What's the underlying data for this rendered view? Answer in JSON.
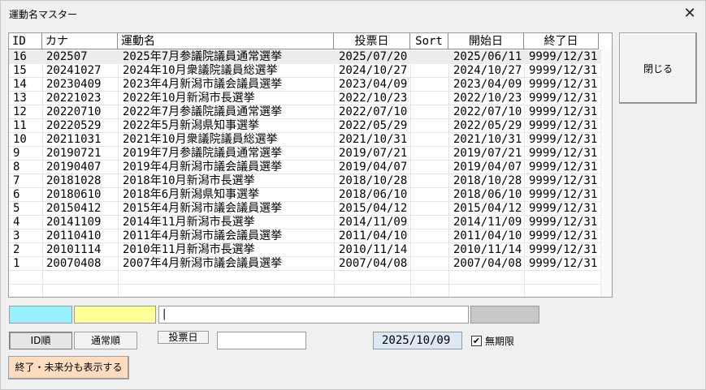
{
  "window": {
    "title": "運動名マスター",
    "close_glyph": "✕"
  },
  "table": {
    "columns": [
      "ID",
      "カナ",
      "運動名",
      "投票日",
      "Sort",
      "開始日",
      "終了日"
    ],
    "rows": [
      [
        "16",
        "202507",
        "2025年7月参議院議員通常選挙",
        "2025/07/20",
        "",
        "2025/06/11",
        "9999/12/31"
      ],
      [
        "15",
        "20241027",
        "2024年10月衆議院議員総選挙",
        "2024/10/27",
        "",
        "2024/10/27",
        "9999/12/31"
      ],
      [
        "14",
        "20230409",
        "2023年4月新潟市議会議員選挙",
        "2023/04/09",
        "",
        "2023/04/09",
        "9999/12/31"
      ],
      [
        "13",
        "20221023",
        "2022年10月新潟市長選挙",
        "2022/10/23",
        "",
        "2022/10/23",
        "9999/12/31"
      ],
      [
        "12",
        "20220710",
        "2022年7月参議院議員通常選挙",
        "2022/07/10",
        "",
        "2022/07/10",
        "9999/12/31"
      ],
      [
        "11",
        "20220529",
        "2022年5月新潟県知事選挙",
        "2022/05/29",
        "",
        "2022/05/29",
        "9999/12/31"
      ],
      [
        "10",
        "20211031",
        "2021年10月衆議院議員総選挙",
        "2021/10/31",
        "",
        "2021/10/31",
        "9999/12/31"
      ],
      [
        "9",
        "20190721",
        "2019年7月参議院議員通常選挙",
        "2019/07/21",
        "",
        "2019/07/21",
        "9999/12/31"
      ],
      [
        "8",
        "20190407",
        "2019年4月新潟市議会議員選挙",
        "2019/04/07",
        "",
        "2019/04/07",
        "9999/12/31"
      ],
      [
        "7",
        "20181028",
        "2018年10月新潟市長選挙",
        "2018/10/28",
        "",
        "2018/10/28",
        "9999/12/31"
      ],
      [
        "6",
        "20180610",
        "2018年6月新潟県知事選挙",
        "2018/06/10",
        "",
        "2018/06/10",
        "9999/12/31"
      ],
      [
        "5",
        "20150412",
        "2015年4月新潟市議会議員選挙",
        "2015/04/12",
        "",
        "2015/04/12",
        "9999/12/31"
      ],
      [
        "4",
        "20141109",
        "2014年11月新潟市長選挙",
        "2014/11/09",
        "",
        "2014/11/09",
        "9999/12/31"
      ],
      [
        "3",
        "20110410",
        "2011年4月新潟市議会議員選挙",
        "2011/04/10",
        "",
        "2011/04/10",
        "9999/12/31"
      ],
      [
        "2",
        "20101114",
        "2010年11月新潟市長選挙",
        "2010/11/14",
        "",
        "2010/11/14",
        "9999/12/31"
      ],
      [
        "1",
        "20070408",
        "2007年4月新潟市議会議員選挙",
        "2007/04/08",
        "",
        "2007/04/08",
        "9999/12/31"
      ]
    ]
  },
  "buttons": {
    "close": "閉じる",
    "sort_id": "ID順",
    "sort_normal": "通常順",
    "show_all": "終了・未来分も表示する"
  },
  "fields": {
    "text_value": "|",
    "vote_label": "投票日",
    "vote_value": "",
    "date_value": "2025/10/09",
    "unlimited_label": "無期限",
    "unlimited_checked": true,
    "check_glyph": "✔"
  },
  "colors": {
    "cyan_field": "#99f0ff",
    "yellow_field": "#ffff99",
    "gray_field": "#c8c8c8",
    "show_button": "#ffdcbf",
    "date_field": "#dde8f7"
  }
}
